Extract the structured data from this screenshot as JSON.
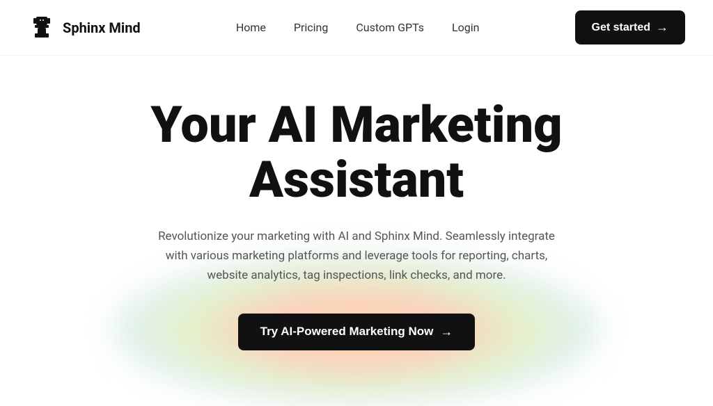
{
  "logo": {
    "text": "Sphinx Mind",
    "icon_alt": "sphinx-logo"
  },
  "nav": {
    "links": [
      {
        "label": "Home",
        "href": "#"
      },
      {
        "label": "Pricing",
        "href": "#"
      },
      {
        "label": "Custom GPTs",
        "href": "#"
      },
      {
        "label": "Login",
        "href": "#"
      }
    ],
    "cta_button": "Get started",
    "cta_arrow": "→"
  },
  "hero": {
    "title": "Your AI Marketing Assistant",
    "subtitle": "Revolutionize your marketing with AI and Sphinx Mind. Seamlessly integrate with various marketing platforms and leverage tools for reporting, charts, website analytics, tag inspections, link checks, and more.",
    "cta_button": "Try AI-Powered Marketing Now",
    "cta_arrow": "→"
  }
}
